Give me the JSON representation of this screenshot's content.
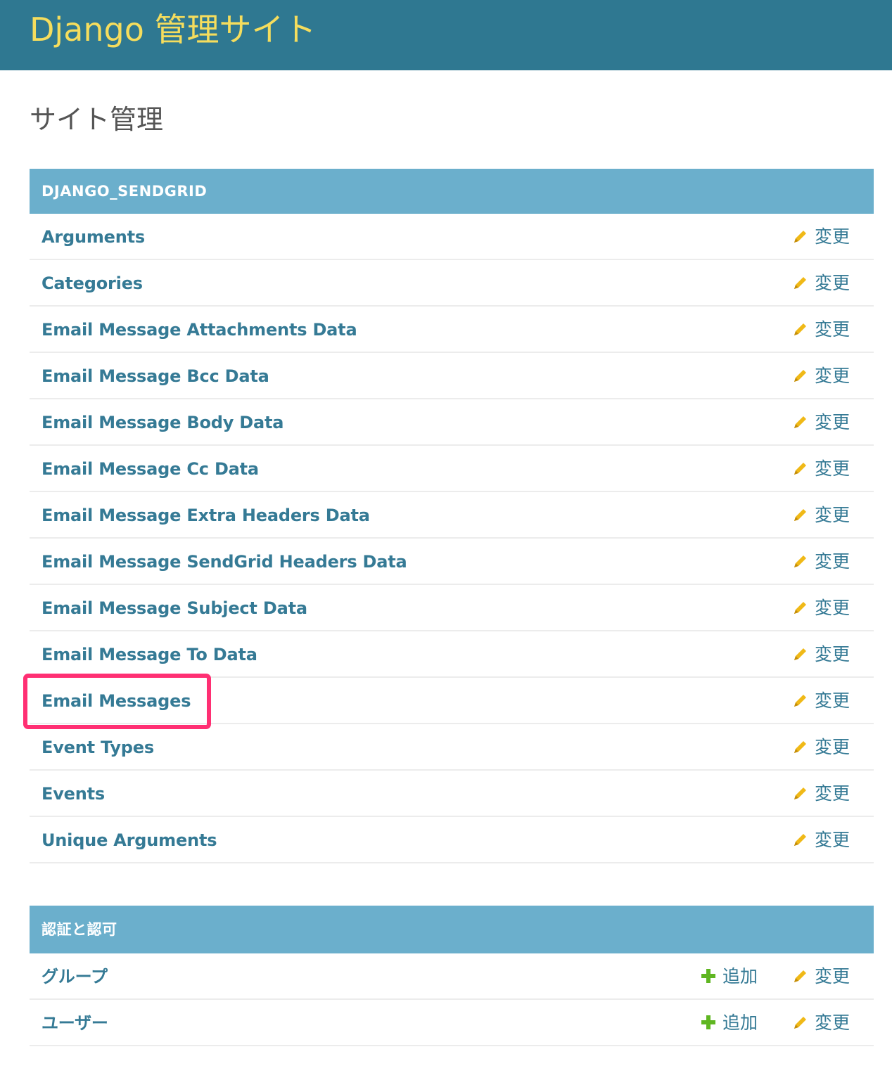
{
  "header": {
    "site_name": "Django 管理サイト"
  },
  "page_title": "サイト管理",
  "modules": [
    {
      "caption": "DJANGO_SENDGRID",
      "rows": [
        {
          "name": "Arguments",
          "change": "変更"
        },
        {
          "name": "Categories",
          "change": "変更"
        },
        {
          "name": "Email Message Attachments Data",
          "change": "変更"
        },
        {
          "name": "Email Message Bcc Data",
          "change": "変更"
        },
        {
          "name": "Email Message Body Data",
          "change": "変更"
        },
        {
          "name": "Email Message Cc Data",
          "change": "変更"
        },
        {
          "name": "Email Message Extra Headers Data",
          "change": "変更"
        },
        {
          "name": "Email Message SendGrid Headers Data",
          "change": "変更"
        },
        {
          "name": "Email Message Subject Data",
          "change": "変更"
        },
        {
          "name": "Email Message To Data",
          "change": "変更"
        },
        {
          "name": "Email Messages",
          "change": "変更"
        },
        {
          "name": "Event Types",
          "change": "変更"
        },
        {
          "name": "Events",
          "change": "変更"
        },
        {
          "name": "Unique Arguments",
          "change": "変更"
        }
      ]
    },
    {
      "caption": "認証と認可",
      "rows": [
        {
          "name": "グループ",
          "add": "追加",
          "change": "変更"
        },
        {
          "name": "ユーザー",
          "add": "追加",
          "change": "変更"
        }
      ]
    }
  ],
  "colors": {
    "header_bg": "#2f7891",
    "brand": "#f5dd5d",
    "caption_bg": "#6bafcc",
    "link": "#357a95",
    "pencil": "#f0b917",
    "plus": "#5fb621",
    "highlight": "#ff2f73"
  },
  "icons": {
    "change": "pencil-icon",
    "add": "plus-icon"
  }
}
